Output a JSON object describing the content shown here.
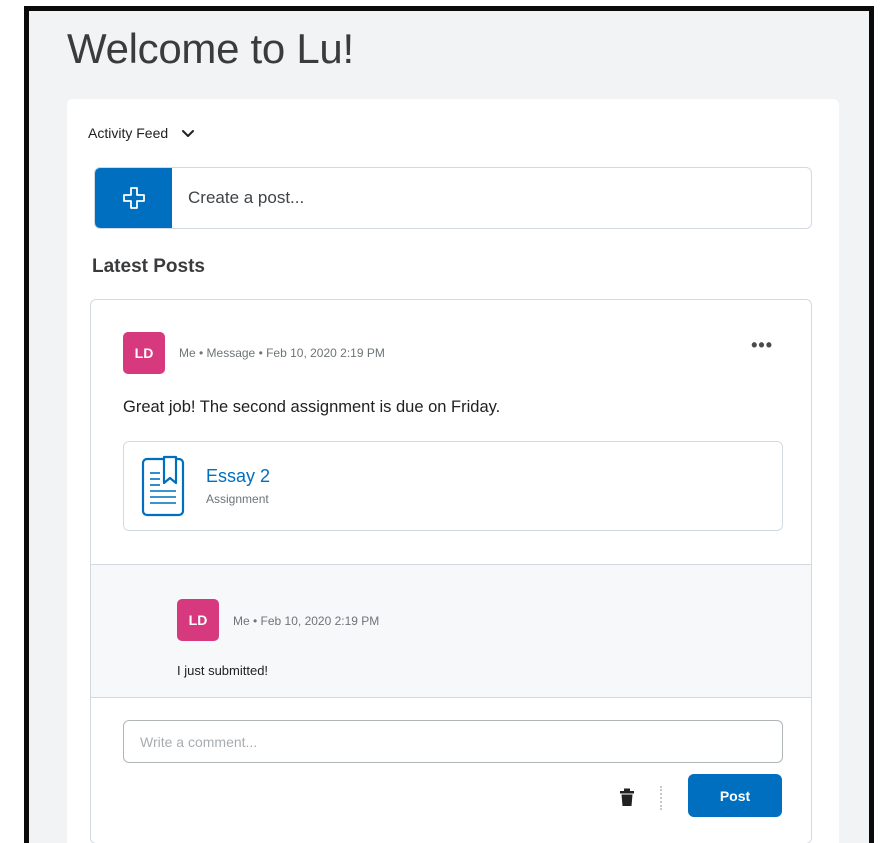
{
  "page": {
    "title": "Welcome to Lu!"
  },
  "feed": {
    "header_label": "Activity Feed",
    "create_post": {
      "placeholder": "Create a post...",
      "icon": "plus-icon"
    },
    "latest_title": "Latest Posts"
  },
  "post": {
    "avatar_initials": "LD",
    "meta": "Me • Message • Feb 10, 2020 2:19 PM",
    "more_label": "•••",
    "text": "Great job! The second assignment is due on Friday.",
    "attachment": {
      "title": "Essay 2",
      "type": "Assignment",
      "icon": "assignment-icon"
    }
  },
  "reply": {
    "avatar_initials": "LD",
    "meta": "Me • Feb 10, 2020 2:19 PM",
    "text": "I just submitted!"
  },
  "comment": {
    "placeholder": "Write a comment...",
    "post_label": "Post"
  },
  "colors": {
    "accent": "#006fbf",
    "avatar": "#d6397d",
    "page_bg": "#f2f3f5"
  }
}
